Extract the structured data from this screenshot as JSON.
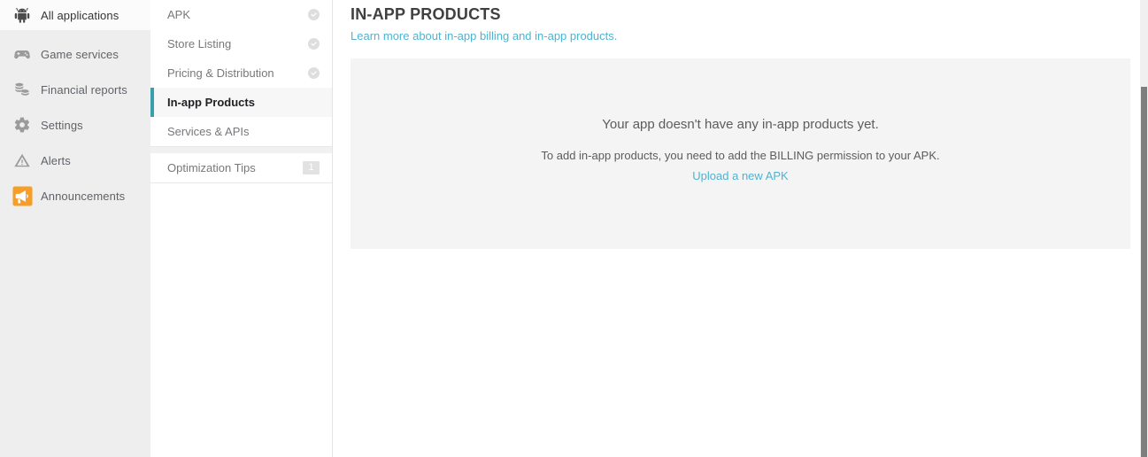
{
  "primary_nav": {
    "items": [
      {
        "label": "All applications",
        "icon": "android-robot-icon",
        "active": true
      },
      {
        "label": "Game services",
        "icon": "gamepad-icon",
        "active": false
      },
      {
        "label": "Financial reports",
        "icon": "coins-stack-icon",
        "active": false
      },
      {
        "label": "Settings",
        "icon": "gear-icon",
        "active": false
      },
      {
        "label": "Alerts",
        "icon": "warning-triangle-icon",
        "active": false
      },
      {
        "label": "Announcements",
        "icon": "megaphone-icon",
        "active": false
      }
    ]
  },
  "secondary_nav": {
    "items": [
      {
        "label": "APK",
        "status_icon": "check-circle-icon",
        "active": false
      },
      {
        "label": "Store Listing",
        "status_icon": "check-circle-icon",
        "active": false
      },
      {
        "label": "Pricing & Distribution",
        "status_icon": "check-circle-icon",
        "active": false
      },
      {
        "label": "In-app Products",
        "status_icon": "",
        "active": true
      },
      {
        "label": "Services & APIs",
        "status_icon": "",
        "active": false
      }
    ],
    "tips": {
      "label": "Optimization Tips",
      "badge": "1"
    }
  },
  "main": {
    "title": "IN-APP PRODUCTS",
    "learn_more_link": "Learn more about in-app billing and in-app products.",
    "empty_state": {
      "title": "Your app doesn't have any in-app products yet.",
      "subtitle": "To add in-app products, you need to add the BILLING permission to your APK.",
      "action_link": "Upload a new APK"
    }
  },
  "colors": {
    "accent_teal": "#39a0ab",
    "link_blue": "#4fb3d0",
    "announcement_orange": "#f79e28",
    "sidebar_bg": "#eeeeee",
    "panel_bg": "#f4f4f4"
  }
}
